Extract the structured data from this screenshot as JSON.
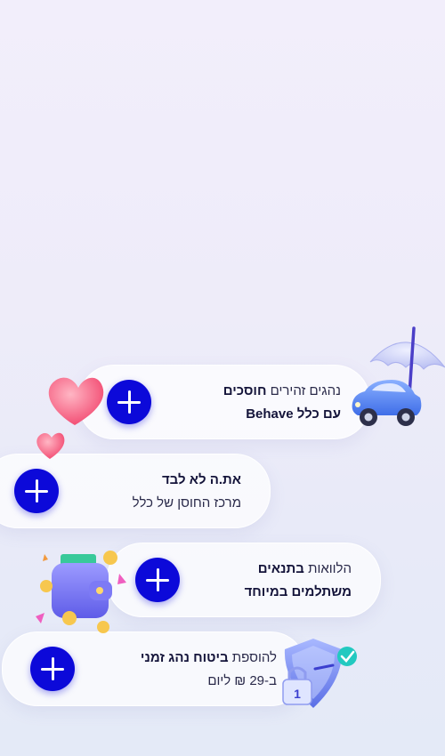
{
  "cards": [
    {
      "line1_pre": "נהגים זהירים ",
      "line1_bold": "חוסכים",
      "line2_bold": "עם כלל Behave",
      "icon": "car-umbrella-icon"
    },
    {
      "line1_bold": "את.ה לא לבד",
      "line2": "מרכז החוסן של כלל",
      "icon": "hearts-icon"
    },
    {
      "line1_pre": "הלוואות ",
      "line1_bold": "בתנאים",
      "line2_bold": "משתלמים במיוחד",
      "icon": "wallet-coins-icon"
    },
    {
      "line1_pre": "להוספת ",
      "line1_bold": "ביטוח נהג זמני",
      "line2": "ב-29 ₪ ליום",
      "icon": "shield-lock-icon"
    }
  ],
  "colors": {
    "accent": "#0c09d9",
    "text": "#2a2a4a"
  },
  "plus_icon": "plus-icon"
}
